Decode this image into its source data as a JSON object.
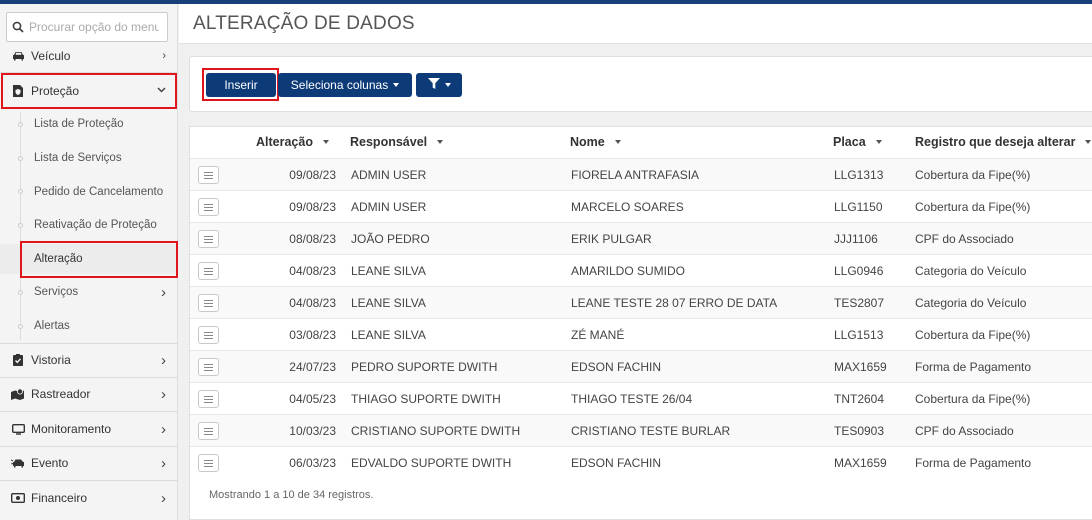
{
  "sidebar": {
    "search_placeholder": "Procurar opção do menu",
    "items": [
      {
        "label": "Veículo"
      },
      {
        "label": "Proteção"
      },
      {
        "label": "Vistoria"
      },
      {
        "label": "Rastreador"
      },
      {
        "label": "Monitoramento"
      },
      {
        "label": "Evento"
      },
      {
        "label": "Financeiro"
      }
    ],
    "subitems": [
      {
        "label": "Lista de Proteção"
      },
      {
        "label": "Lista de Serviços"
      },
      {
        "label": "Pedido de Cancelamento"
      },
      {
        "label": "Reativação de Proteção"
      },
      {
        "label": "Alteração"
      },
      {
        "label": "Serviços"
      },
      {
        "label": "Alertas"
      }
    ]
  },
  "page": {
    "title": "ALTERAÇÃO DE DADOS"
  },
  "toolbar": {
    "insert_label": "Inserir",
    "columns_label": "Seleciona colunas"
  },
  "table": {
    "headers": [
      "Alteração",
      "Responsável",
      "Nome",
      "Placa",
      "Registro que deseja alterar"
    ],
    "rows": [
      {
        "date": "09/08/23",
        "resp": "ADMIN USER",
        "nome": "FIORELA ANTRAFASIA",
        "placa": "LLG1313",
        "registro": "Cobertura da Fipe(%)"
      },
      {
        "date": "09/08/23",
        "resp": "ADMIN USER",
        "nome": "MARCELO SOARES",
        "placa": "LLG1150",
        "registro": "Cobertura da Fipe(%)"
      },
      {
        "date": "08/08/23",
        "resp": "JOÃO PEDRO",
        "nome": "ERIK PULGAR",
        "placa": "JJJ1106",
        "registro": "CPF do Associado"
      },
      {
        "date": "04/08/23",
        "resp": "LEANE SILVA",
        "nome": "AMARILDO SUMIDO",
        "placa": "LLG0946",
        "registro": "Categoria do Veículo"
      },
      {
        "date": "04/08/23",
        "resp": "LEANE SILVA",
        "nome": "LEANE TESTE 28 07 ERRO DE DATA",
        "placa": "TES2807",
        "registro": "Categoria do Veículo"
      },
      {
        "date": "03/08/23",
        "resp": "LEANE SILVA",
        "nome": "ZÉ MANÉ",
        "placa": "LLG1513",
        "registro": "Cobertura da Fipe(%)"
      },
      {
        "date": "24/07/23",
        "resp": "PEDRO SUPORTE DWITH",
        "nome": "EDSON FACHIN",
        "placa": "MAX1659",
        "registro": "Forma de Pagamento"
      },
      {
        "date": "04/05/23",
        "resp": "THIAGO SUPORTE DWITH",
        "nome": "THIAGO TESTE 26/04",
        "placa": "TNT2604",
        "registro": "Cobertura da Fipe(%)"
      },
      {
        "date": "10/03/23",
        "resp": "CRISTIANO SUPORTE DWITH",
        "nome": "CRISTIANO TESTE BURLAR",
        "placa": "TES0903",
        "registro": "CPF do Associado"
      },
      {
        "date": "06/03/23",
        "resp": "EDVALDO SUPORTE DWITH",
        "nome": "EDSON FACHIN",
        "placa": "MAX1659",
        "registro": "Forma de Pagamento"
      }
    ],
    "footer": "Mostrando 1 a 10 de 34 registros."
  },
  "colors": {
    "primary": "#0d3b78",
    "highlight": "#e0141b"
  }
}
